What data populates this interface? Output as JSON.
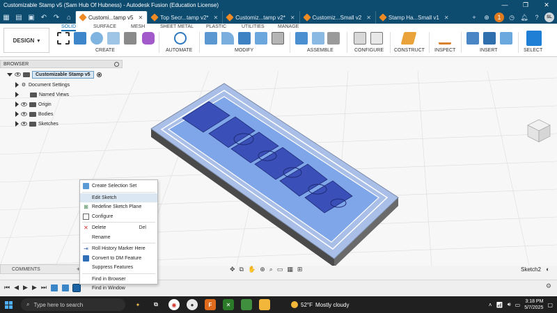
{
  "window": {
    "title": "Customizable Stamp v5 (Sam Hub Of Hubness) - Autodesk Fusion (Education License)",
    "controls": [
      "—",
      "❐",
      "✕"
    ]
  },
  "tabs": [
    {
      "label": "Customi...tamp v5",
      "active": true
    },
    {
      "label": "Top Secr...tamp v2*",
      "active": false
    },
    {
      "label": "Customiz...tamp v2*",
      "active": false
    },
    {
      "label": "Customiz...Small v2",
      "active": false
    },
    {
      "label": "Stamp Ha...Small v1",
      "active": false
    }
  ],
  "account": {
    "badge": "1",
    "initials": "SL"
  },
  "ribbon": {
    "workspace": "DESIGN",
    "tabs": [
      "SOLID",
      "SURFACE",
      "MESH",
      "SHEET METAL",
      "PLASTIC",
      "UTILITIES",
      "MANAGE"
    ],
    "groups": [
      "CREATE",
      "AUTOMATE",
      "MODIFY",
      "ASSEMBLE",
      "CONFIGURE",
      "CONSTRUCT",
      "INSPECT",
      "INSERT",
      "SELECT"
    ]
  },
  "browser": {
    "header": "BROWSER",
    "root": "Customizable Stamp v5",
    "items": [
      "Document Settings",
      "Named Views",
      "Origin",
      "Bodies",
      "Sketches"
    ]
  },
  "context_menu": {
    "items": [
      {
        "label": "Create Selection Set",
        "icon": "selection-set-icon",
        "shortcut": ""
      },
      {
        "label": "Edit Sketch",
        "icon": "edit-sketch-icon",
        "shortcut": "",
        "highlight": true
      },
      {
        "label": "Redefine Sketch Plane",
        "icon": "sketch-plane-icon",
        "shortcut": ""
      },
      {
        "label": "Configure",
        "icon": "configure-icon",
        "shortcut": ""
      },
      {
        "label": "Delete",
        "icon": "delete-icon",
        "shortcut": "Del"
      },
      {
        "label": "Rename",
        "icon": "",
        "shortcut": ""
      },
      {
        "label": "Roll History Marker Here",
        "icon": "history-marker-icon",
        "shortcut": ""
      },
      {
        "label": "Convert to DM Feature",
        "icon": "convert-icon",
        "shortcut": ""
      },
      {
        "label": "Suppress Features",
        "icon": "",
        "shortcut": ""
      },
      {
        "label": "Find in Browser",
        "icon": "",
        "shortcut": ""
      },
      {
        "label": "Find in Window",
        "icon": "",
        "shortcut": ""
      }
    ]
  },
  "bottom": {
    "comments": "COMMENTS",
    "active_sketch": "Sketch2"
  },
  "taskbar": {
    "search_placeholder": "Type here to search",
    "weather_temp": "52°F",
    "weather_desc": "Mostly cloudy",
    "time": "3:18 PM",
    "date": "5/7/2025"
  },
  "colors": {
    "titlebar": "#0d4b6f",
    "accent": "#0a6fb5",
    "sketch_fill": "#7fa6e8",
    "text_fill": "#3b4fb8",
    "plate": "#5a5a5a"
  }
}
